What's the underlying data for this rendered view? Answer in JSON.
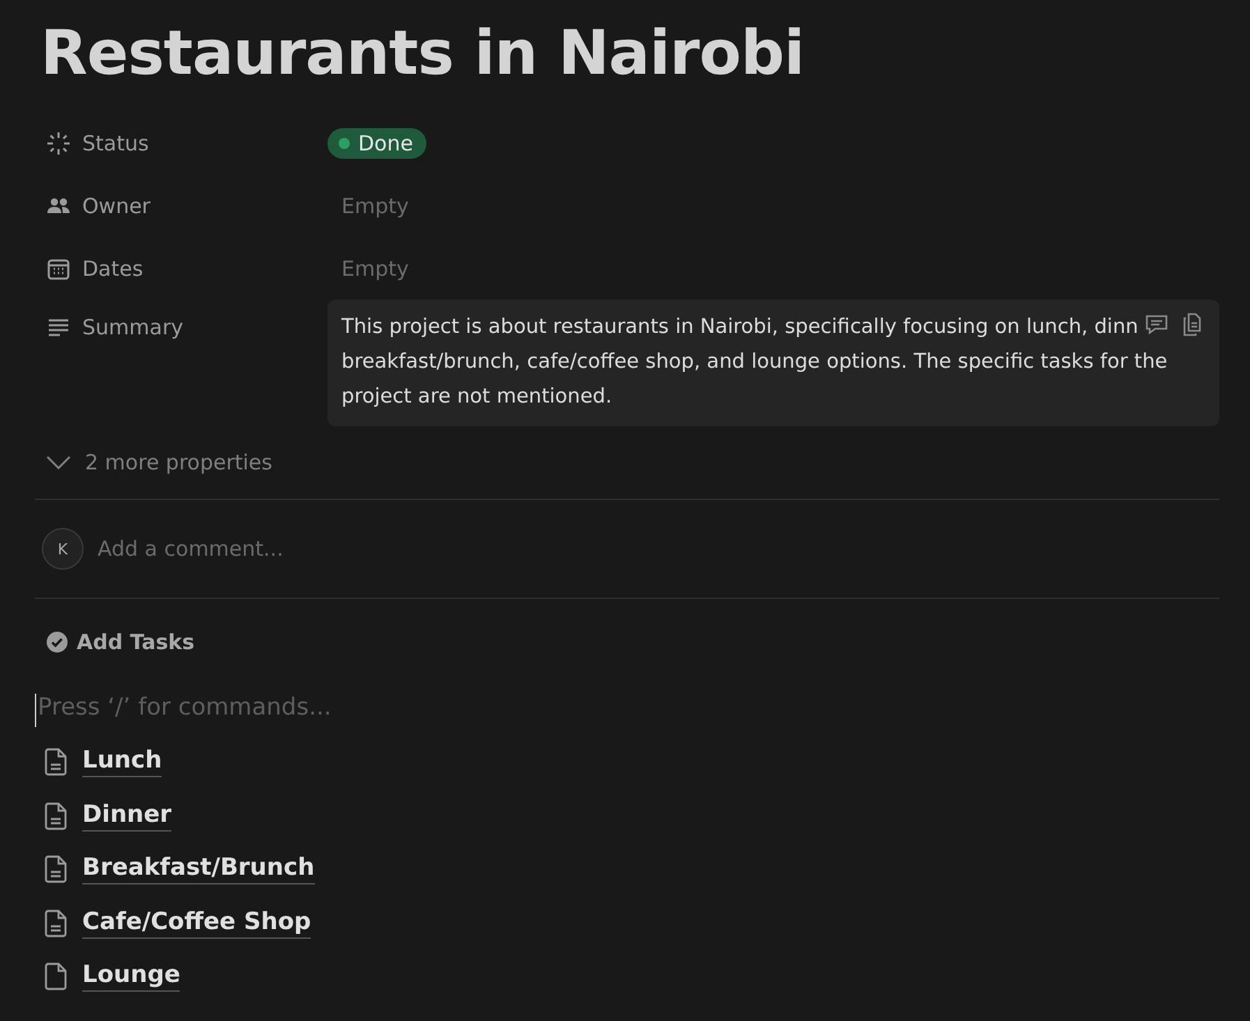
{
  "title": "Restaurants in Nairobi",
  "properties": [
    {
      "kind": "status",
      "label": "Status",
      "value": "Done",
      "color": "#2f9e65"
    },
    {
      "kind": "empty",
      "label": "Owner",
      "value": "Empty"
    },
    {
      "kind": "empty",
      "label": "Dates",
      "value": "Empty"
    },
    {
      "kind": "summary",
      "label": "Summary",
      "lines": [
        "This project is about restaurants in Nairobi, specifically focusing on lunch, dinn",
        "breakfast/brunch, cafe/coffee shop, and lounge options. The specific tasks for the",
        "project are not mentioned."
      ]
    }
  ],
  "more_properties": "2 more properties",
  "comment": {
    "avatar": "K",
    "placeholder": "Add a comment..."
  },
  "section": "Add Tasks",
  "editor": {
    "placeholder": "Press ‘/’ for commands..."
  },
  "pages": [
    {
      "kind": "page",
      "title": "Lunch"
    },
    {
      "kind": "page",
      "title": "Dinner"
    },
    {
      "kind": "page",
      "title": "Breakfast/Brunch"
    },
    {
      "kind": "page",
      "title": "Cafe/Coffee Shop"
    },
    {
      "kind": "empty-page",
      "title": "Lounge"
    }
  ]
}
